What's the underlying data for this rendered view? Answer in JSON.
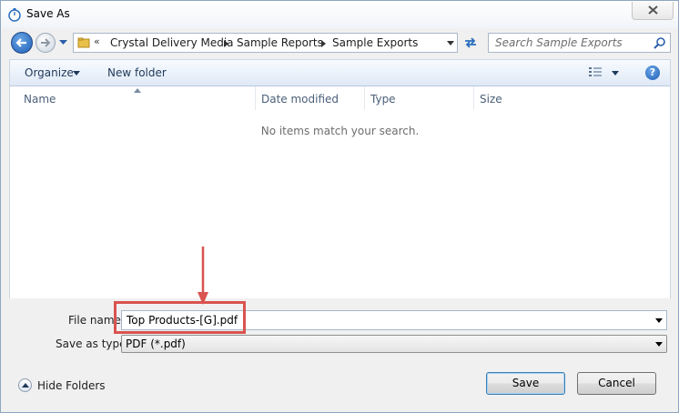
{
  "window": {
    "title": "Save As"
  },
  "address": {
    "chevron": "«",
    "crumbs": [
      "Crystal Delivery Media",
      "Sample Reports",
      "Sample Exports"
    ]
  },
  "search": {
    "placeholder": "Search Sample Exports"
  },
  "toolbar": {
    "organize_label": "Organize",
    "new_folder_label": "New folder",
    "help_label": "?"
  },
  "filelist": {
    "columns": [
      "Name",
      "Date modified",
      "Type",
      "Size"
    ],
    "empty_message": "No items match your search."
  },
  "form": {
    "filename_label": "File name",
    "filename_value": "Top Products-[G].pdf",
    "savetype_label": "Save as type:",
    "savetype_value": "PDF (*.pdf)"
  },
  "footer": {
    "hide_folders_label": "Hide Folders",
    "save_label": "Save",
    "cancel_label": "Cancel"
  },
  "colors": {
    "annotation": "#d9534f",
    "accent": "#1f5fb6"
  }
}
